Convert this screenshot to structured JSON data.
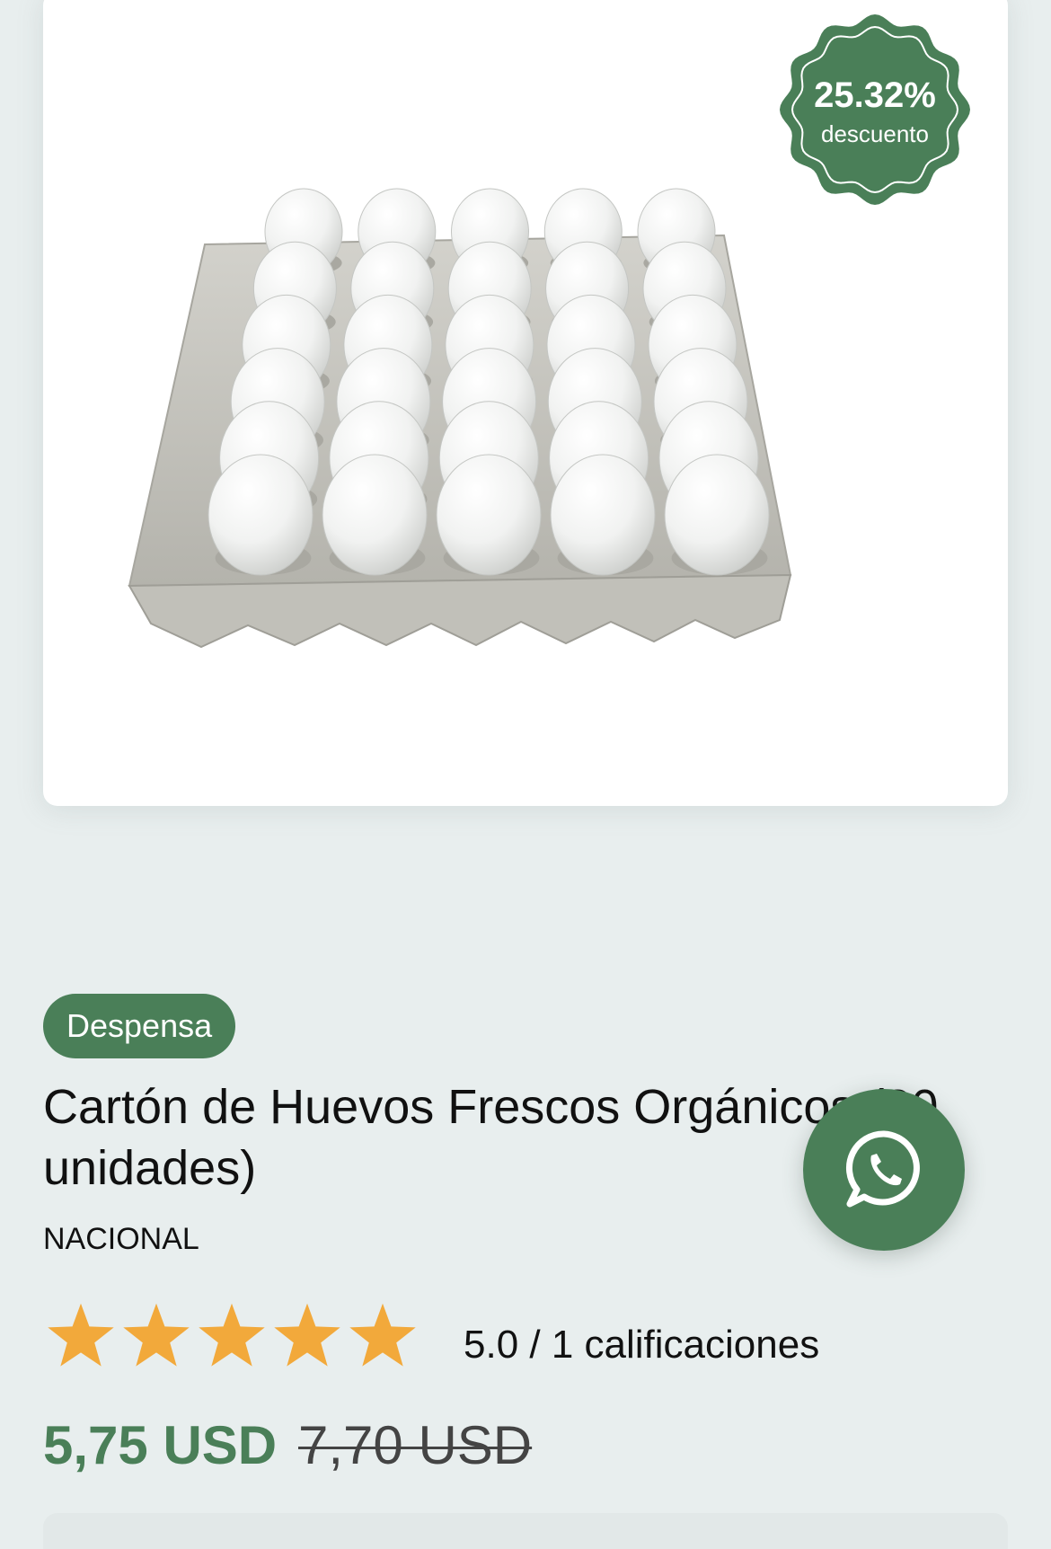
{
  "product": {
    "image_alt": "egg-tray-photo",
    "discount": {
      "percent": "25.32%",
      "label": "descuento"
    },
    "category": "Despensa",
    "title": "Cartón de Huevos Frescos Orgánicos (30 unidades)",
    "brand": "NACIONAL",
    "rating": {
      "stars": 5,
      "max_stars": 5,
      "text": "5.0 / 1 calificaciones"
    },
    "price": {
      "current": "5,75 USD",
      "old": "7,70 USD"
    }
  },
  "colors": {
    "accent": "#4a7f58",
    "star": "#f2a93b",
    "background": "#e8eeee"
  },
  "icons": {
    "whatsapp": "whatsapp-icon",
    "badge": "discount-seal-icon",
    "star": "star-icon"
  }
}
